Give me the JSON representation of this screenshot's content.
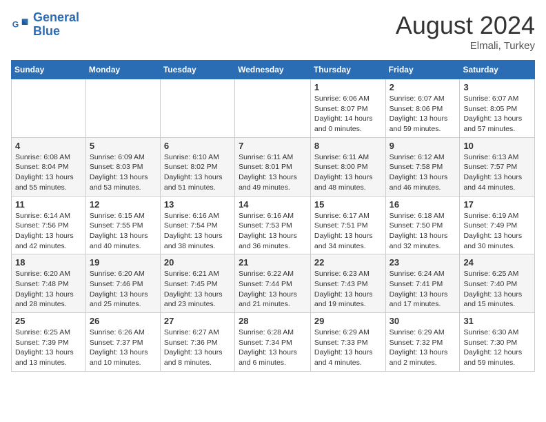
{
  "header": {
    "logo_line1": "General",
    "logo_line2": "Blue",
    "month_year": "August 2024",
    "location": "Elmali, Turkey"
  },
  "days_of_week": [
    "Sunday",
    "Monday",
    "Tuesday",
    "Wednesday",
    "Thursday",
    "Friday",
    "Saturday"
  ],
  "weeks": [
    [
      {
        "day": "",
        "info": ""
      },
      {
        "day": "",
        "info": ""
      },
      {
        "day": "",
        "info": ""
      },
      {
        "day": "",
        "info": ""
      },
      {
        "day": "1",
        "info": "Sunrise: 6:06 AM\nSunset: 8:07 PM\nDaylight: 14 hours\nand 0 minutes."
      },
      {
        "day": "2",
        "info": "Sunrise: 6:07 AM\nSunset: 8:06 PM\nDaylight: 13 hours\nand 59 minutes."
      },
      {
        "day": "3",
        "info": "Sunrise: 6:07 AM\nSunset: 8:05 PM\nDaylight: 13 hours\nand 57 minutes."
      }
    ],
    [
      {
        "day": "4",
        "info": "Sunrise: 6:08 AM\nSunset: 8:04 PM\nDaylight: 13 hours\nand 55 minutes."
      },
      {
        "day": "5",
        "info": "Sunrise: 6:09 AM\nSunset: 8:03 PM\nDaylight: 13 hours\nand 53 minutes."
      },
      {
        "day": "6",
        "info": "Sunrise: 6:10 AM\nSunset: 8:02 PM\nDaylight: 13 hours\nand 51 minutes."
      },
      {
        "day": "7",
        "info": "Sunrise: 6:11 AM\nSunset: 8:01 PM\nDaylight: 13 hours\nand 49 minutes."
      },
      {
        "day": "8",
        "info": "Sunrise: 6:11 AM\nSunset: 8:00 PM\nDaylight: 13 hours\nand 48 minutes."
      },
      {
        "day": "9",
        "info": "Sunrise: 6:12 AM\nSunset: 7:58 PM\nDaylight: 13 hours\nand 46 minutes."
      },
      {
        "day": "10",
        "info": "Sunrise: 6:13 AM\nSunset: 7:57 PM\nDaylight: 13 hours\nand 44 minutes."
      }
    ],
    [
      {
        "day": "11",
        "info": "Sunrise: 6:14 AM\nSunset: 7:56 PM\nDaylight: 13 hours\nand 42 minutes."
      },
      {
        "day": "12",
        "info": "Sunrise: 6:15 AM\nSunset: 7:55 PM\nDaylight: 13 hours\nand 40 minutes."
      },
      {
        "day": "13",
        "info": "Sunrise: 6:16 AM\nSunset: 7:54 PM\nDaylight: 13 hours\nand 38 minutes."
      },
      {
        "day": "14",
        "info": "Sunrise: 6:16 AM\nSunset: 7:53 PM\nDaylight: 13 hours\nand 36 minutes."
      },
      {
        "day": "15",
        "info": "Sunrise: 6:17 AM\nSunset: 7:51 PM\nDaylight: 13 hours\nand 34 minutes."
      },
      {
        "day": "16",
        "info": "Sunrise: 6:18 AM\nSunset: 7:50 PM\nDaylight: 13 hours\nand 32 minutes."
      },
      {
        "day": "17",
        "info": "Sunrise: 6:19 AM\nSunset: 7:49 PM\nDaylight: 13 hours\nand 30 minutes."
      }
    ],
    [
      {
        "day": "18",
        "info": "Sunrise: 6:20 AM\nSunset: 7:48 PM\nDaylight: 13 hours\nand 28 minutes."
      },
      {
        "day": "19",
        "info": "Sunrise: 6:20 AM\nSunset: 7:46 PM\nDaylight: 13 hours\nand 25 minutes."
      },
      {
        "day": "20",
        "info": "Sunrise: 6:21 AM\nSunset: 7:45 PM\nDaylight: 13 hours\nand 23 minutes."
      },
      {
        "day": "21",
        "info": "Sunrise: 6:22 AM\nSunset: 7:44 PM\nDaylight: 13 hours\nand 21 minutes."
      },
      {
        "day": "22",
        "info": "Sunrise: 6:23 AM\nSunset: 7:43 PM\nDaylight: 13 hours\nand 19 minutes."
      },
      {
        "day": "23",
        "info": "Sunrise: 6:24 AM\nSunset: 7:41 PM\nDaylight: 13 hours\nand 17 minutes."
      },
      {
        "day": "24",
        "info": "Sunrise: 6:25 AM\nSunset: 7:40 PM\nDaylight: 13 hours\nand 15 minutes."
      }
    ],
    [
      {
        "day": "25",
        "info": "Sunrise: 6:25 AM\nSunset: 7:39 PM\nDaylight: 13 hours\nand 13 minutes."
      },
      {
        "day": "26",
        "info": "Sunrise: 6:26 AM\nSunset: 7:37 PM\nDaylight: 13 hours\nand 10 minutes."
      },
      {
        "day": "27",
        "info": "Sunrise: 6:27 AM\nSunset: 7:36 PM\nDaylight: 13 hours\nand 8 minutes."
      },
      {
        "day": "28",
        "info": "Sunrise: 6:28 AM\nSunset: 7:34 PM\nDaylight: 13 hours\nand 6 minutes."
      },
      {
        "day": "29",
        "info": "Sunrise: 6:29 AM\nSunset: 7:33 PM\nDaylight: 13 hours\nand 4 minutes."
      },
      {
        "day": "30",
        "info": "Sunrise: 6:29 AM\nSunset: 7:32 PM\nDaylight: 13 hours\nand 2 minutes."
      },
      {
        "day": "31",
        "info": "Sunrise: 6:30 AM\nSunset: 7:30 PM\nDaylight: 12 hours\nand 59 minutes."
      }
    ]
  ]
}
